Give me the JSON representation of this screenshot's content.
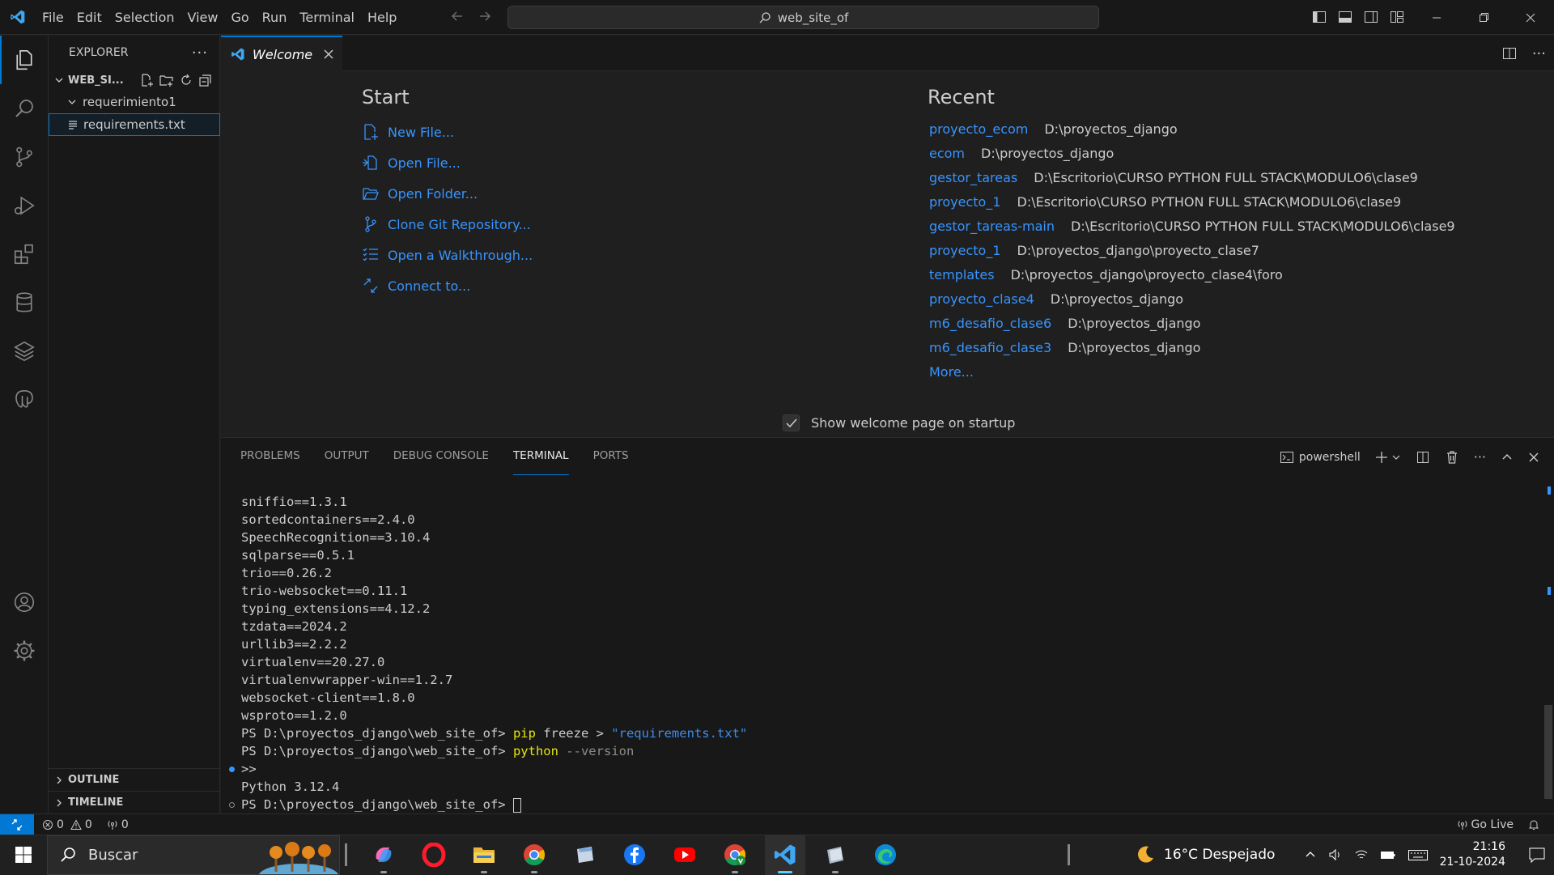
{
  "titlebar": {
    "menu": [
      "File",
      "Edit",
      "Selection",
      "View",
      "Go",
      "Run",
      "Terminal",
      "Help"
    ],
    "search_text": "web_site_of"
  },
  "sidebar": {
    "title": "EXPLORER",
    "folder": "WEB_SI...",
    "tree": [
      {
        "label": "requerimiento1",
        "type": "folder"
      },
      {
        "label": "requirements.txt",
        "type": "file"
      }
    ],
    "outline": "OUTLINE",
    "timeline": "TIMELINE"
  },
  "tabs": {
    "active": "Welcome"
  },
  "welcome": {
    "start_title": "Start",
    "start_items": [
      {
        "label": "New File...",
        "icon": "new-file-icon"
      },
      {
        "label": "Open File...",
        "icon": "open-file-icon"
      },
      {
        "label": "Open Folder...",
        "icon": "open-folder-icon"
      },
      {
        "label": "Clone Git Repository...",
        "icon": "git-icon"
      },
      {
        "label": "Open a Walkthrough...",
        "icon": "checklist-icon"
      },
      {
        "label": "Connect to...",
        "icon": "remote-icon"
      }
    ],
    "recent_title": "Recent",
    "recent": [
      {
        "name": "proyecto_ecom",
        "path": "D:\\proyectos_django"
      },
      {
        "name": "ecom",
        "path": "D:\\proyectos_django"
      },
      {
        "name": "gestor_tareas",
        "path": "D:\\Escritorio\\CURSO PYTHON FULL STACK\\MODULO6\\clase9"
      },
      {
        "name": "proyecto_1",
        "path": "D:\\Escritorio\\CURSO PYTHON FULL STACK\\MODULO6\\clase9"
      },
      {
        "name": "gestor_tareas-main",
        "path": "D:\\Escritorio\\CURSO PYTHON FULL STACK\\MODULO6\\clase9"
      },
      {
        "name": "proyecto_1",
        "path": "D:\\proyectos_django\\proyecto_clase7"
      },
      {
        "name": "templates",
        "path": "D:\\proyectos_django\\proyecto_clase4\\foro"
      },
      {
        "name": "proyecto_clase4",
        "path": "D:\\proyectos_django"
      },
      {
        "name": "m6_desafio_clase6",
        "path": "D:\\proyectos_django"
      },
      {
        "name": "m6_desafio_clase3",
        "path": "D:\\proyectos_django"
      }
    ],
    "more": "More...",
    "show_on_startup": "Show welcome page on startup"
  },
  "panel": {
    "tabs": [
      "PROBLEMS",
      "OUTPUT",
      "DEBUG CONSOLE",
      "TERMINAL",
      "PORTS"
    ],
    "active_tab": "TERMINAL",
    "shell": "powershell"
  },
  "terminal": {
    "packages": [
      "sniffio==1.3.1",
      "sortedcontainers==2.4.0",
      "SpeechRecognition==3.10.4",
      "sqlparse==0.5.1",
      "trio==0.26.2",
      "trio-websocket==0.11.1",
      "typing_extensions==4.12.2",
      "tzdata==2024.2",
      "urllib3==2.2.2",
      "virtualenv==20.27.0",
      "virtualenvwrapper-win==1.2.7",
      "websocket-client==1.8.0",
      "wsproto==1.2.0"
    ],
    "prompt": "PS D:\\proyectos_django\\web_site_of> ",
    "cmd1": "pip",
    "cmd1_rest": " freeze > ",
    "cmd1_str": "\"requirements.txt\"",
    "cmd2": "python",
    "cmd2_rest": " --version",
    "cont": ">>",
    "output": "Python 3.12.4"
  },
  "statusbar": {
    "errors": "0",
    "warnings": "0",
    "ports": "0",
    "golive": "Go Live"
  },
  "taskbar": {
    "search": "Buscar",
    "weather": "16°C  Despejado",
    "time": "21:16",
    "date": "21-10-2024"
  }
}
